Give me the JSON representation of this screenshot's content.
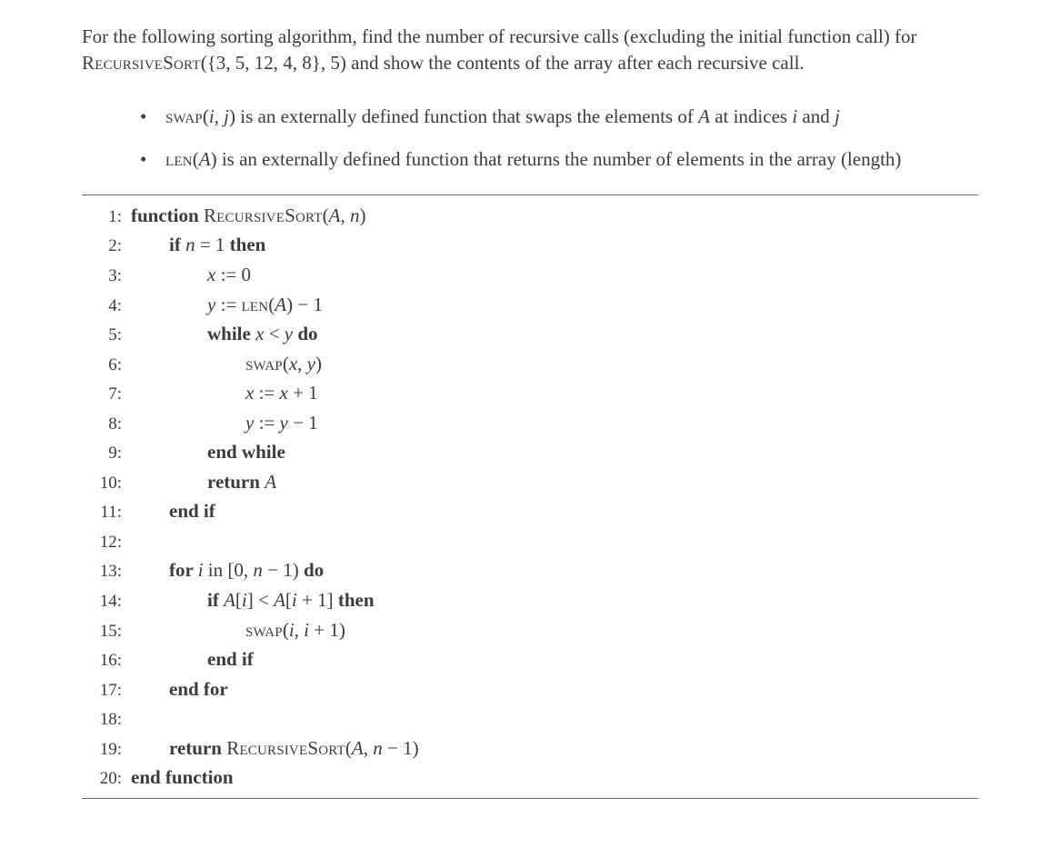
{
  "problem": {
    "sentence_part1": "For the following sorting algorithm, find the number of recursive calls (excluding the initial function call) for ",
    "func_name_sc": "RecursiveSort",
    "func_args": "({3, 5, 12, 4, 8}, 5)",
    "sentence_part2": " and show the contents of the array after each recursive call."
  },
  "bullet1": {
    "a": "swap",
    "args": "(i, j)",
    "b": " is an externally defined function that swaps the elements of ",
    "A": "A",
    "c": " at indices ",
    "i": "i",
    "d": " and ",
    "j": "j"
  },
  "bullet2": {
    "a": "len",
    "args": "(A)",
    "b": " is an externally defined function that returns the number of elements in the array (length)"
  },
  "algo": {
    "lines": [
      {
        "no": "1:",
        "indent": 0,
        "tokens": [
          {
            "t": "function ",
            "kw": true
          },
          {
            "t": "RecursiveSort",
            "sc": true
          },
          {
            "t": "("
          },
          {
            "t": "A",
            "it": true
          },
          {
            "t": ", "
          },
          {
            "t": "n",
            "it": true
          },
          {
            "t": ")"
          }
        ]
      },
      {
        "no": "2:",
        "indent": 1,
        "tokens": [
          {
            "t": "if ",
            "kw": true
          },
          {
            "t": "n",
            "it": true
          },
          {
            "t": " = 1 "
          },
          {
            "t": "then",
            "kw": true
          }
        ]
      },
      {
        "no": "3:",
        "indent": 2,
        "tokens": [
          {
            "t": "x",
            "it": true
          },
          {
            "t": " := 0"
          }
        ]
      },
      {
        "no": "4:",
        "indent": 2,
        "tokens": [
          {
            "t": "y",
            "it": true
          },
          {
            "t": " := "
          },
          {
            "t": "len",
            "sc": true
          },
          {
            "t": "("
          },
          {
            "t": "A",
            "it": true
          },
          {
            "t": ") − 1"
          }
        ]
      },
      {
        "no": "5:",
        "indent": 2,
        "tokens": [
          {
            "t": "while ",
            "kw": true
          },
          {
            "t": "x",
            "it": true
          },
          {
            "t": " < "
          },
          {
            "t": "y",
            "it": true
          },
          {
            "t": " do",
            "kw": true
          }
        ]
      },
      {
        "no": "6:",
        "indent": 3,
        "tokens": [
          {
            "t": "swap",
            "sc": true
          },
          {
            "t": "("
          },
          {
            "t": "x",
            "it": true
          },
          {
            "t": ", "
          },
          {
            "t": "y",
            "it": true
          },
          {
            "t": ")"
          }
        ]
      },
      {
        "no": "7:",
        "indent": 3,
        "tokens": [
          {
            "t": "x",
            "it": true
          },
          {
            "t": " := "
          },
          {
            "t": "x",
            "it": true
          },
          {
            "t": " + 1"
          }
        ]
      },
      {
        "no": "8:",
        "indent": 3,
        "tokens": [
          {
            "t": "y",
            "it": true
          },
          {
            "t": " := "
          },
          {
            "t": "y",
            "it": true
          },
          {
            "t": " − 1"
          }
        ]
      },
      {
        "no": "9:",
        "indent": 2,
        "tokens": [
          {
            "t": "end while",
            "kw": true
          }
        ]
      },
      {
        "no": "10:",
        "indent": 2,
        "tokens": [
          {
            "t": "return ",
            "kw": true
          },
          {
            "t": "A",
            "it": true
          }
        ]
      },
      {
        "no": "11:",
        "indent": 1,
        "tokens": [
          {
            "t": "end if",
            "kw": true
          }
        ]
      },
      {
        "no": "12:",
        "indent": 1,
        "tokens": [
          {
            "t": ""
          }
        ]
      },
      {
        "no": "13:",
        "indent": 1,
        "tokens": [
          {
            "t": "for ",
            "kw": true
          },
          {
            "t": "i",
            "it": true
          },
          {
            "t": " in [0, "
          },
          {
            "t": "n",
            "it": true
          },
          {
            "t": " − 1) "
          },
          {
            "t": "do",
            "kw": true
          }
        ]
      },
      {
        "no": "14:",
        "indent": 2,
        "tokens": [
          {
            "t": "if ",
            "kw": true
          },
          {
            "t": "A",
            "it": true
          },
          {
            "t": "["
          },
          {
            "t": "i",
            "it": true
          },
          {
            "t": "] < "
          },
          {
            "t": "A",
            "it": true
          },
          {
            "t": "["
          },
          {
            "t": "i",
            "it": true
          },
          {
            "t": " + 1] "
          },
          {
            "t": "then",
            "kw": true
          }
        ]
      },
      {
        "no": "15:",
        "indent": 3,
        "tokens": [
          {
            "t": "swap",
            "sc": true
          },
          {
            "t": "("
          },
          {
            "t": "i",
            "it": true
          },
          {
            "t": ", "
          },
          {
            "t": "i",
            "it": true
          },
          {
            "t": " + 1)"
          }
        ]
      },
      {
        "no": "16:",
        "indent": 2,
        "tokens": [
          {
            "t": "end if",
            "kw": true
          }
        ]
      },
      {
        "no": "17:",
        "indent": 1,
        "tokens": [
          {
            "t": "end for",
            "kw": true
          }
        ]
      },
      {
        "no": "18:",
        "indent": 1,
        "tokens": [
          {
            "t": ""
          }
        ]
      },
      {
        "no": "19:",
        "indent": 1,
        "tokens": [
          {
            "t": "return ",
            "kw": true
          },
          {
            "t": "RecursiveSort",
            "sc": true
          },
          {
            "t": "("
          },
          {
            "t": "A",
            "it": true
          },
          {
            "t": ", "
          },
          {
            "t": "n",
            "it": true
          },
          {
            "t": " − 1)"
          }
        ]
      },
      {
        "no": "20:",
        "indent": 0,
        "tokens": [
          {
            "t": "end function",
            "kw": true
          }
        ]
      }
    ]
  }
}
